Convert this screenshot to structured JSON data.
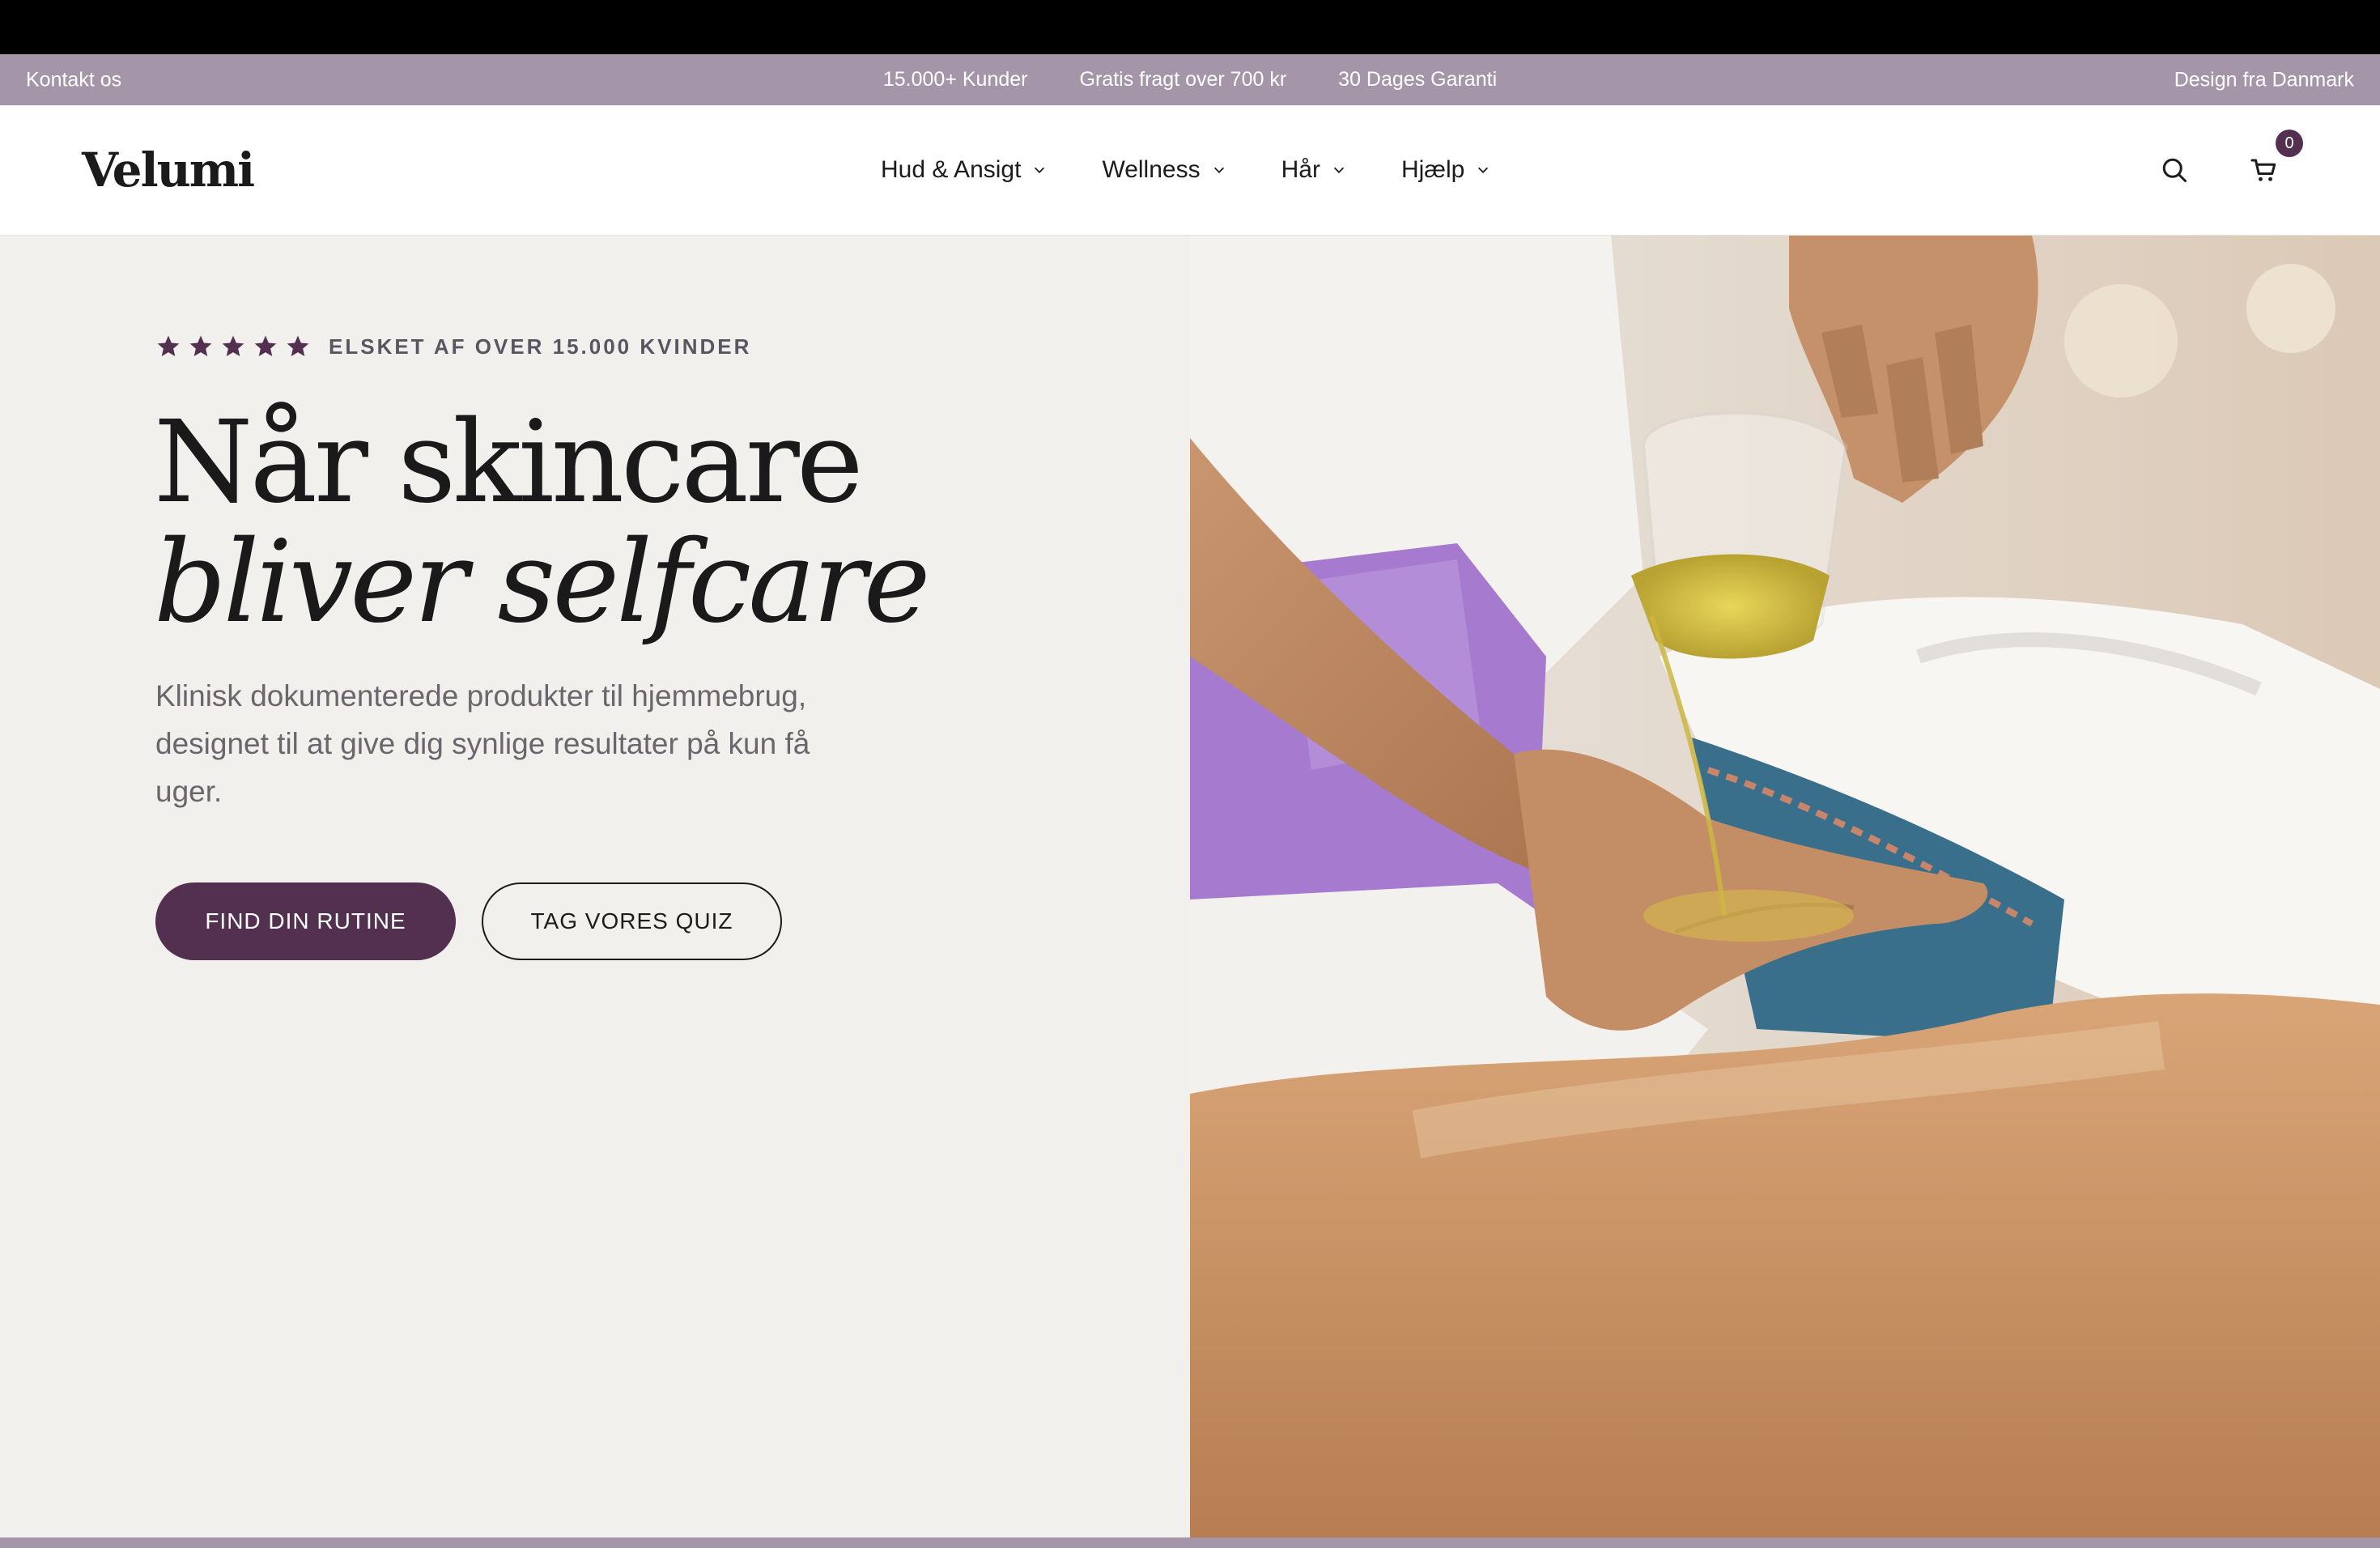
{
  "announcement": {
    "contact": "Kontakt os",
    "items": [
      "15.000+ Kunder",
      "Gratis fragt over 700 kr",
      "30 Dages Garanti"
    ],
    "right": "Design fra Danmark"
  },
  "header": {
    "logo": "Velumi",
    "nav": [
      {
        "label": "Hud & Ansigt"
      },
      {
        "label": "Wellness"
      },
      {
        "label": "Hår"
      },
      {
        "label": "Hjælp"
      }
    ],
    "cart_count": "0"
  },
  "hero": {
    "rating": {
      "stars": 5,
      "text": "ELSKET AF OVER 15.000 KVINDER"
    },
    "title_line1": "Når skincare",
    "title_line2": "bliver selfcare",
    "subtitle": "Klinisk dokumenterede produkter til hjemmebrug, designet til at give dig synlige resultater på kun få uger.",
    "cta_primary": "FIND DIN RUTINE",
    "cta_secondary": "TAG VORES QUIZ"
  },
  "colors": {
    "accent": "#533050",
    "announcement_bg": "#a496a8",
    "hero_bg": "#f2f0ed"
  }
}
